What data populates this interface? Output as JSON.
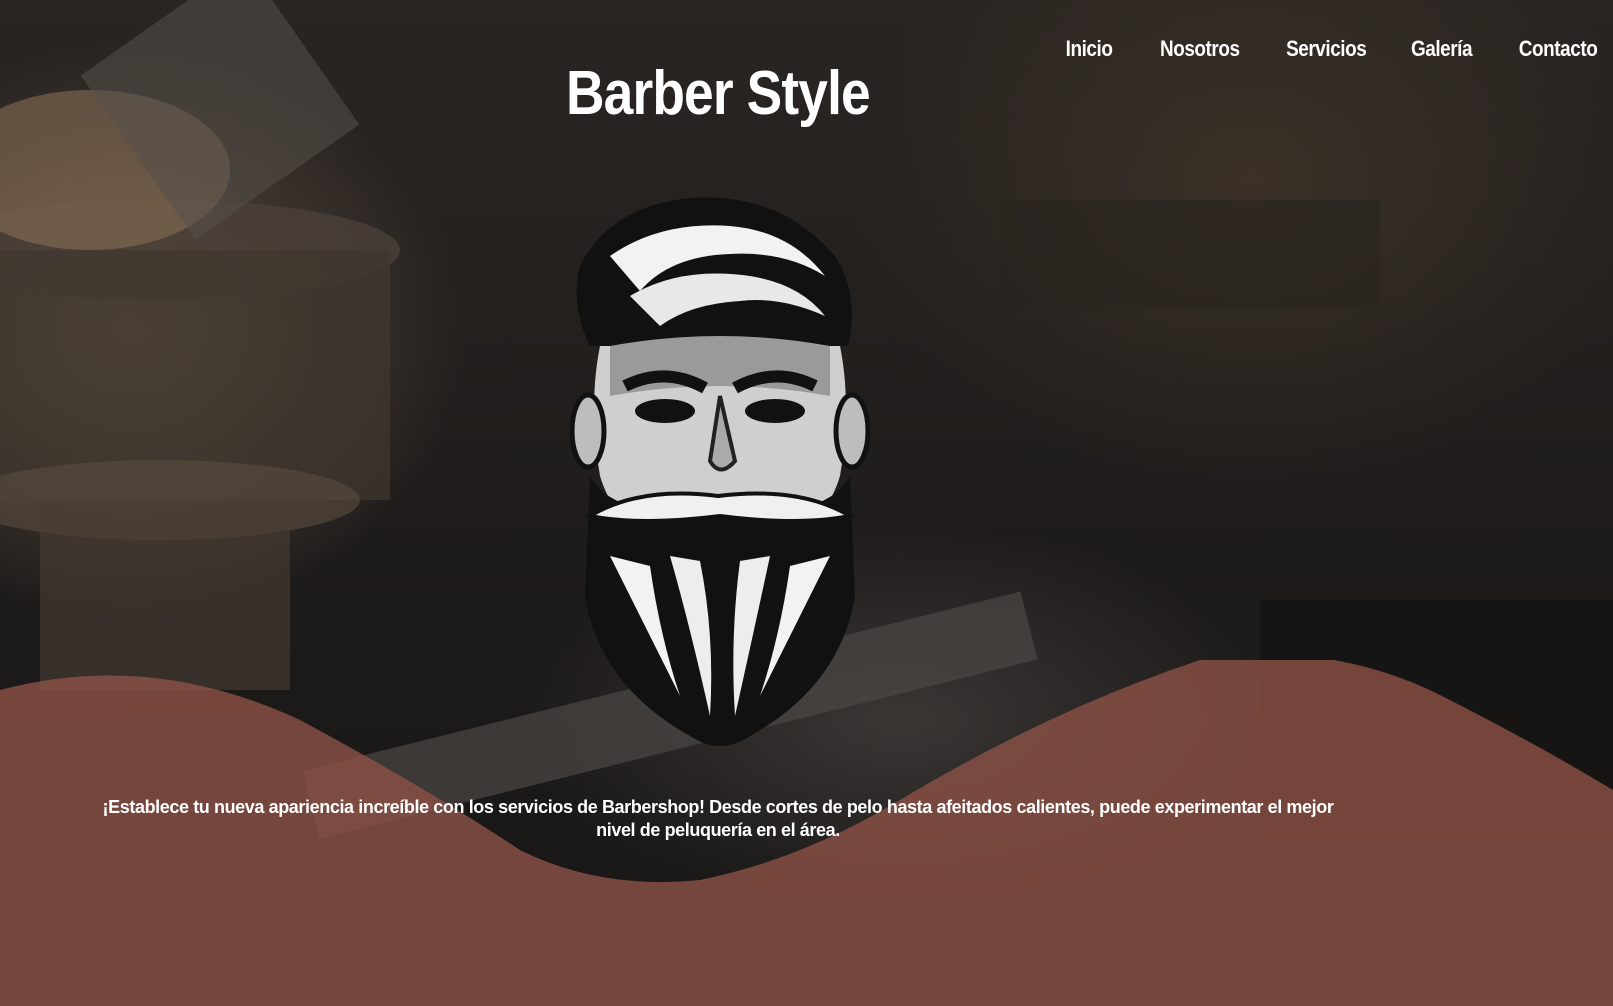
{
  "nav": {
    "items": [
      {
        "label": "Inicio"
      },
      {
        "label": "Nosotros"
      },
      {
        "label": "Servicios"
      },
      {
        "label": "Galería"
      },
      {
        "label": "Contacto"
      }
    ]
  },
  "hero": {
    "title": "Barber Style",
    "logo_icon": "bearded-man-logo-icon",
    "tagline": "¡Establece tu nueva apariencia increíble con los servicios de Barbershop! Desde cortes de pelo hasta afeitados calientes, puede experimentar el mejor nivel de peluquería en el área."
  },
  "colors": {
    "wave": "#8a5046",
    "text": "#ffffff"
  }
}
